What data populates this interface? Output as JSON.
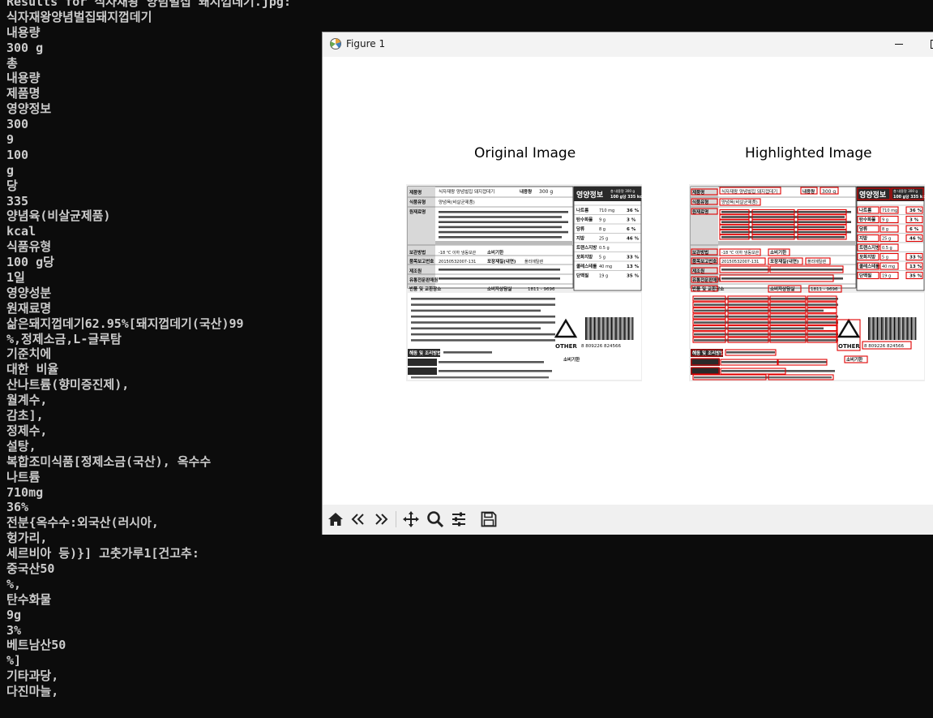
{
  "terminal": {
    "lines": [
      "Results for 식자재왕 양념벌집 돼지껍데기.jpg:",
      "식자재왕양념벌집돼지껍데기",
      "내용량",
      "300 g",
      "총",
      "내용량",
      "제품명",
      "영양정보",
      "300",
      "9",
      "100",
      "g",
      "당",
      "335",
      "양념육(비살균제품)",
      "kcal",
      "식품유형",
      "100 g당",
      "1일",
      "영양성분",
      "원재료명",
      "삶은돼지껍데기62.95%[돼지껍데기(국산)99",
      "%,정제소금,L-글루탐",
      "기준치에",
      "대한 비율",
      "산나트륨(향미증진제),",
      "월계수,",
      "감초],",
      "정제수,",
      "설탕,",
      "복합조미식품[정제소금(국산), 옥수수",
      "나트륨",
      "710mg",
      "36%",
      "전분{옥수수:외국산(러시아,",
      "헝가리,",
      "세르비아 등)}] 고춧가루1[건고추:",
      "중국산50",
      "%,",
      "탄수화물",
      "9g",
      "3%",
      "베트남산50",
      "%]",
      "기타과당,",
      "다진마늘,"
    ]
  },
  "figure": {
    "window_title": "Figure 1",
    "subplots": [
      {
        "title": "Original Image"
      },
      {
        "title": "Highlighted Image"
      }
    ],
    "label_images": {
      "row_labels": [
        "제품명",
        "식품유형",
        "원재료명",
        "보관방법",
        "품목보고번호",
        "제조원",
        "유통전문판매원",
        "반품 및 교환장소"
      ],
      "product_name": "식자재왕 양념벌집 돼지껍데기",
      "content_label": "내용량",
      "content_value": "300 g",
      "food_type": "양념육(비살균제품)",
      "nutrition_header": "영양정보",
      "nutrition_total": "총 내용량 300 g",
      "nutrition_kcal": "100 g당 335 kcal",
      "nutrition_rows": [
        {
          "name": "나트륨",
          "amount": "710 mg",
          "pct": "36 %"
        },
        {
          "name": "탄수화물",
          "amount": "9 g",
          "pct": "3 %"
        },
        {
          "name": "당류",
          "amount": "8 g",
          "pct": "6 %"
        },
        {
          "name": "지방",
          "amount": "25 g",
          "pct": "46 %"
        },
        {
          "name": "트랜스지방",
          "amount": "0.5 g",
          "pct": ""
        },
        {
          "name": "포화지방",
          "amount": "5 g",
          "pct": "33 %"
        },
        {
          "name": "콜레스테롤",
          "amount": "40 mg",
          "pct": "13 %"
        },
        {
          "name": "단백질",
          "amount": "19 g",
          "pct": "35 %"
        }
      ],
      "storage": "-18 ℃ 이하 냉동보관",
      "expiry_label": "소비기한",
      "report_no": "20150532007-131",
      "packaging_label": "포장재질(내면)",
      "packaging_value": "폴리에틸렌",
      "consumer_line_label": "소비자상담실",
      "consumer_line": "1811 - 9696",
      "recycle_mark": "OTHER",
      "barcode_digits": "8 809226 824566",
      "howto_label": "해동 및 조리방법",
      "expiry_label_2": "소비기한"
    }
  },
  "toolbar": {
    "tools": [
      "home-icon",
      "back-arrow-icon",
      "forward-arrow-icon",
      "pan-icon",
      "zoom-icon",
      "configure-subplots-icon",
      "save-icon"
    ]
  }
}
